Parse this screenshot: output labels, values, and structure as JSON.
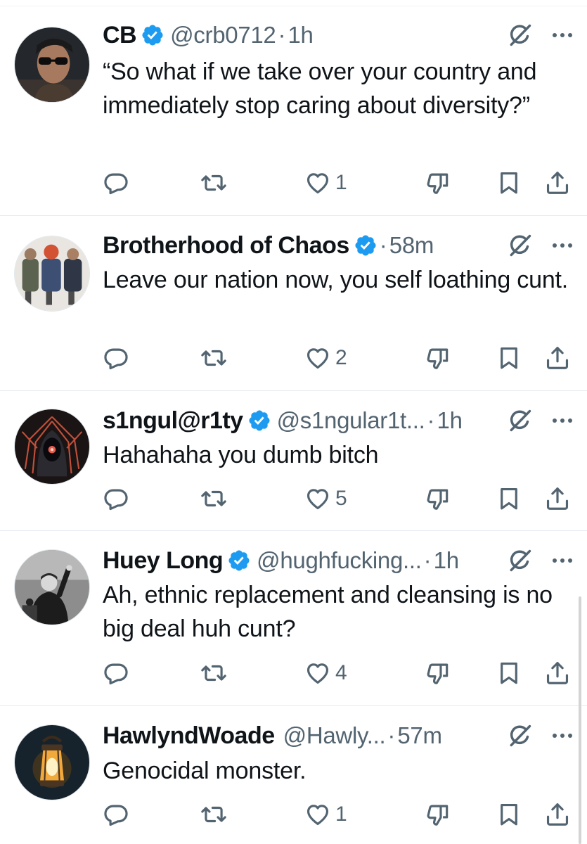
{
  "tweets": [
    {
      "name": "CB",
      "handle": "@crb0712",
      "dot": "·",
      "time": "1h",
      "text": "“So what if we take over your country and immediately stop caring about diversity?”",
      "likes": "1",
      "avatar": "man-with-sunglasses-avatar"
    },
    {
      "name": "Brotherhood of Chaos",
      "handle": "",
      "dot": "·",
      "time": "58m",
      "text": "Leave our nation now, you self loathing cunt.",
      "likes": "2",
      "avatar": "group-of-men-avatar"
    },
    {
      "name": "s1ngul@r1ty",
      "handle": "@s1ngular1t...",
      "dot": "·",
      "time": "1h",
      "text": "Hahahaha you dumb bitch",
      "likes": "5",
      "avatar": "hooded-figure-avatar"
    },
    {
      "name": "Huey Long",
      "handle": "@hughfucking...",
      "dot": "·",
      "time": "1h",
      "text": "Ah, ethnic replacement and cleansing is no big deal huh cunt?",
      "likes": "4",
      "avatar": "speaker-at-podium-avatar"
    },
    {
      "name": "HawlyndWoade",
      "handle": "@Hawly...",
      "dot": "·",
      "time": "57m",
      "text": "Genocidal monster.",
      "likes": "1",
      "avatar": "lantern-avatar"
    }
  ],
  "colors": {
    "verified": "#1d9bf0",
    "secondary_text": "#536471",
    "icon": "#536471",
    "divider": "#e6ecf0"
  },
  "icons": [
    "reply-icon",
    "retweet-icon",
    "like-icon",
    "downvote-icon",
    "bookmark-icon",
    "share-icon",
    "grok-icon",
    "more-icon",
    "verified-badge-icon"
  ]
}
